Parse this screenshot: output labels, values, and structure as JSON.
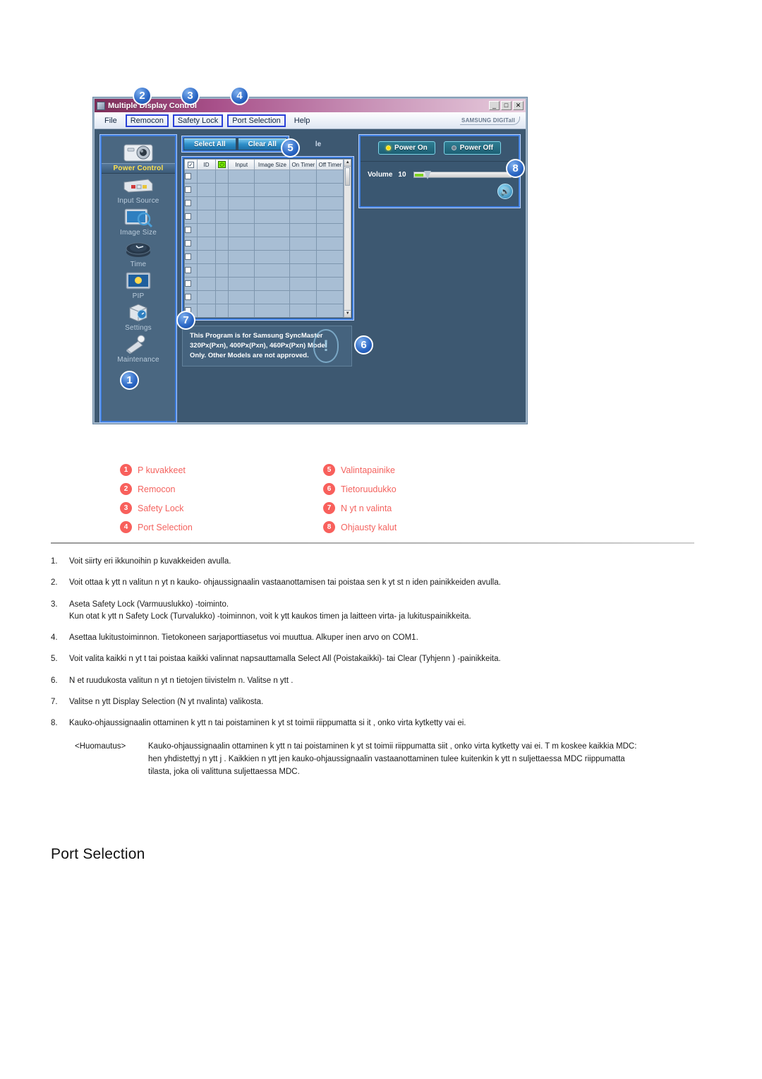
{
  "app": {
    "title": "Multiple Display Control",
    "window_buttons": [
      "_",
      "□",
      "✕"
    ],
    "brand": "SAMSUNG DIGITall",
    "menu": [
      {
        "label": "File",
        "boxed": false
      },
      {
        "label": "Remocon",
        "boxed": true
      },
      {
        "label": "Safety Lock",
        "boxed": true
      },
      {
        "label": "Port Selection",
        "boxed": true
      },
      {
        "label": "Help",
        "boxed": false
      }
    ],
    "sidebar": {
      "items": [
        {
          "label": "Power Control",
          "icon": "power-control-icon",
          "active": true
        },
        {
          "label": "Input Source",
          "icon": "input-source-icon",
          "active": false
        },
        {
          "label": "Image Size",
          "icon": "image-size-icon",
          "active": false
        },
        {
          "label": "Time",
          "icon": "clock-icon",
          "active": false
        },
        {
          "label": "PIP",
          "icon": "pip-icon",
          "active": false
        },
        {
          "label": "Settings",
          "icon": "settings-cube-icon",
          "active": false
        },
        {
          "label": "Maintenance",
          "icon": "maintenance-icon",
          "active": false
        }
      ]
    },
    "toolbar": {
      "select_all": "Select All",
      "clear_all": "Clear All",
      "schedule_partial": "le"
    },
    "grid": {
      "headers": [
        "",
        "ID",
        "power-icon",
        "Input",
        "Image Size",
        "On Timer",
        "Off Timer"
      ],
      "row_count": 11,
      "rows": []
    },
    "controls": {
      "power_on": "Power On",
      "power_off": "Power Off",
      "volume_label": "Volume",
      "volume_value": "10",
      "speaker_icon": "speaker-icon"
    },
    "footer_note": "This Program is for Samsung SyncMaster 320Px(Pxn), 400Px(Pxn), 460Px(Pxn)  Model Only. Other Models are not approved.",
    "callouts": [
      {
        "n": "1"
      },
      {
        "n": "2"
      },
      {
        "n": "3"
      },
      {
        "n": "4"
      },
      {
        "n": "5"
      },
      {
        "n": "6"
      },
      {
        "n": "7"
      },
      {
        "n": "8"
      }
    ]
  },
  "legend": {
    "left": [
      {
        "n": "1",
        "label": "P  kuvakkeet"
      },
      {
        "n": "2",
        "label": "Remocon"
      },
      {
        "n": "3",
        "label": "Safety Lock"
      },
      {
        "n": "4",
        "label": "Port Selection"
      }
    ],
    "right": [
      {
        "n": "5",
        "label": "Valintapainike"
      },
      {
        "n": "6",
        "label": "Tietoruudukko"
      },
      {
        "n": "7",
        "label": "N yt n valinta"
      },
      {
        "n": "8",
        "label": "Ohjausty kalut"
      }
    ]
  },
  "steps": [
    {
      "num": "1.",
      "text": "Voit siirty  eri ikkunoihin p  kuvakkeiden avulla.",
      "sub": ""
    },
    {
      "num": "2.",
      "text": "Voit ottaa k ytt  n valitun n yt n kauko- ohjaussignaalin vastaanottamisen tai poistaa sen k yt st  n iden painikkeiden avulla.",
      "sub": ""
    },
    {
      "num": "3.",
      "text": "Aseta Safety Lock (Varmuuslukko) -toiminto.",
      "sub": "Kun otat k ytt  n Safety Lock (Turvalukko) -toiminnon,     voit k ytt   kaukos  timen ja laitteen virta- ja lukituspainikkeita."
    },
    {
      "num": "4.",
      "text": "Asettaa lukitustoiminnon. Tietokoneen sarjaporttiasetus voi muuttua. Alkuper inen arvo on COM1.",
      "sub": ""
    },
    {
      "num": "5.",
      "text": "Voit valita kaikki n yt t tai poistaa kaikki valinnat napsauttamalla Select All (Poistakaikki)- tai Clear (Tyhjenn ) -painikkeita.",
      "sub": ""
    },
    {
      "num": "6.",
      "text": "N et ruudukosta valitun n yt n tietojen tiivistelm n. Valitse n ytt .",
      "sub": ""
    },
    {
      "num": "7.",
      "text": "Valitse n ytt  Display Selection (N yt nvalinta) valikosta.",
      "sub": ""
    },
    {
      "num": "8.",
      "text": "Kauko-ohjaussignaalin ottaminen k ytt  n tai poistaminen k     yt st  toimii riippumatta si  it , onko virta kytketty vai ei.",
      "sub": ""
    }
  ],
  "note": {
    "label": "<Huomautus>",
    "text": "Kauko-ohjaussignaalin ottaminen k ytt  n tai poistaminen k yt st  toimii riippumatta siit , onko virta kytketty vai ei. T m  koskee kaikkia MDC:  hen yhdistettyj  n ytt j . Kaikkien n ytt jen kauko-ohjaussignaalin vastaanottaminen tulee kuitenkin k ytt  n suljettaessa MDC riippumatta tilasta, joka oli valittuna suljettaessa MDC."
  },
  "section": {
    "heading": "Port Selection"
  },
  "colors": {
    "badge_blue": "#2a66c4",
    "legend_red": "#f8605c",
    "title_magenta": "#a8508a",
    "panel_blue": "#3d5871",
    "accent_cyan": "#3f7fe0"
  }
}
